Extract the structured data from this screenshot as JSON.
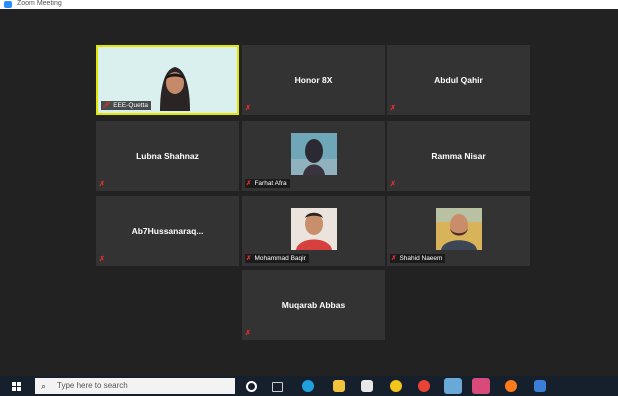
{
  "window": {
    "title": "Zoom Meeting"
  },
  "tiles": [
    {
      "name": "",
      "tag": "EEE-Quetta",
      "muted": false,
      "type": "video-woman"
    },
    {
      "name": "Honor 8X",
      "muted": true,
      "type": "name"
    },
    {
      "name": "Abdul Qahir",
      "muted": true,
      "type": "name"
    },
    {
      "name": "Lubna Shahnaz",
      "muted": true,
      "type": "name"
    },
    {
      "name": "",
      "tag": "Farhat Afra",
      "muted": true,
      "type": "photo"
    },
    {
      "name": "Ramma Nisar",
      "muted": true,
      "type": "name"
    },
    {
      "name": "Ab7Hussanaraq...",
      "muted": true,
      "type": "name"
    },
    {
      "name": "",
      "tag": "Mohammad Baqir",
      "muted": true,
      "type": "photo"
    },
    {
      "name": "",
      "tag": "Shahid Naeem",
      "muted": true,
      "type": "photo"
    },
    {
      "name": "Muqarab Abbas",
      "muted": true,
      "type": "name"
    }
  ],
  "taskbar": {
    "search_placeholder": "Type here to search",
    "icons": [
      "windows-start-icon",
      "cortana-icon",
      "task-view-icon",
      "edge-icon",
      "file-explorer-icon",
      "store-icon",
      "chrome-canary-icon",
      "chrome-icon",
      "zoom-icon",
      "app-icon",
      "firefox-icon",
      "monitor-icon"
    ]
  },
  "colors": {
    "stage": "#222222",
    "tile": "#333333",
    "active_border": "#e2e600",
    "muted_red": "#e02f2f",
    "taskbar": "#16202c"
  }
}
